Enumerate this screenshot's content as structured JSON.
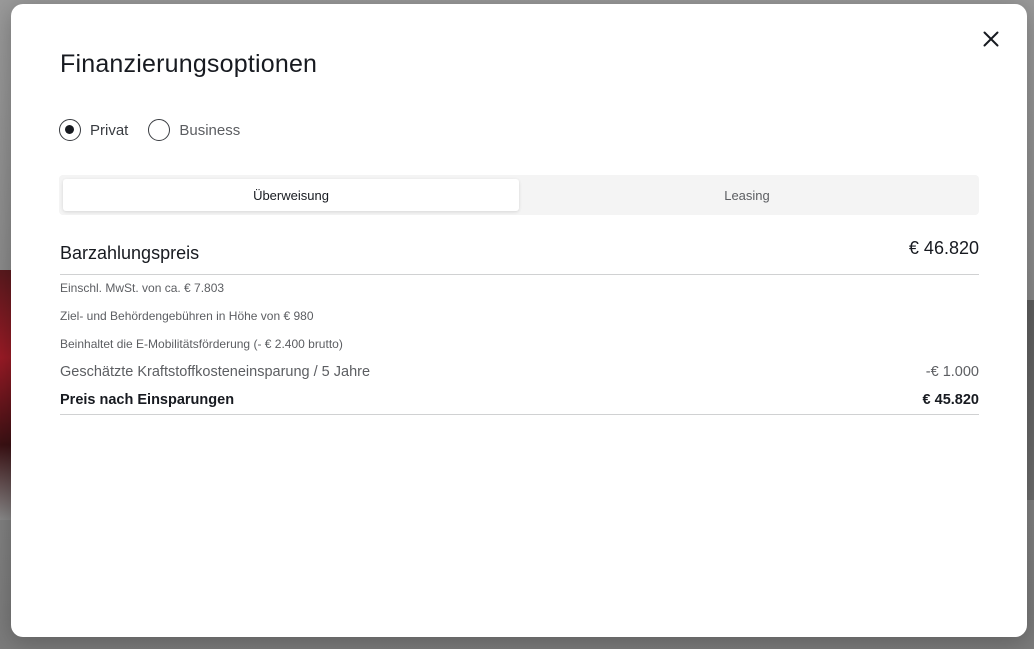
{
  "modal": {
    "title": "Finanzierungsoptionen"
  },
  "customer_type": {
    "options": [
      {
        "label": "Privat",
        "checked": true
      },
      {
        "label": "Business",
        "checked": false
      }
    ]
  },
  "tabs": [
    {
      "label": "Überweisung",
      "active": true
    },
    {
      "label": "Leasing",
      "active": false
    }
  ],
  "price": {
    "label": "Barzahlungspreis",
    "value": "€ 46.820"
  },
  "notes": [
    "Einschl. MwSt. von ca. € 7.803",
    "Ziel- und Behördengebühren in Höhe von € 980",
    "Beinhaltet die E-Mobilitätsförderung (- € 2.400 brutto)"
  ],
  "savings": {
    "label": "Geschätzte Kraftstoffkosteneinsparung / 5 Jahre",
    "value": "-€ 1.000"
  },
  "final_price": {
    "label": "Preis nach Einsparungen",
    "value": "€ 45.820"
  },
  "icons": {
    "close": "close-icon"
  }
}
